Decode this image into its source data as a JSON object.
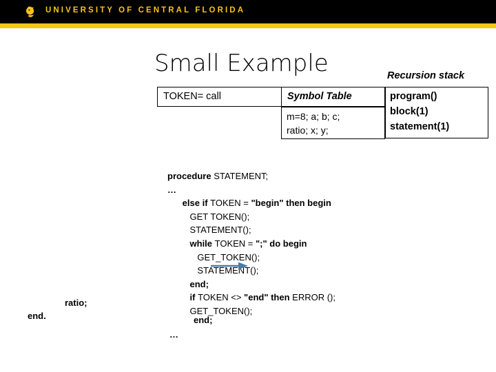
{
  "header": {
    "wordmark": "UNIVERSITY OF CENTRAL FLORIDA",
    "logo_icon": "ucf-pegasus-logo-icon",
    "bar_color": "#000000",
    "stripe_color": "#f5c518",
    "text_color": "#f5c518"
  },
  "slide": {
    "title": "Small Example"
  },
  "token_box": {
    "text": "TOKEN= call"
  },
  "symbol_table": {
    "header": "Symbol Table",
    "entries_line1": "m=8; a; b; c;",
    "entries_line2": "ratio; x; y;"
  },
  "recursion_stack": {
    "label": "Recursion stack",
    "frames": [
      "program()",
      "block(1)",
      "statement(1)"
    ]
  },
  "code": {
    "lines": [
      {
        "indent": 0,
        "segments": [
          {
            "text": "procedure ",
            "bold": true
          },
          {
            "text": "STATEMENT;",
            "bold": false
          }
        ]
      },
      {
        "indent": 0,
        "segments": [
          {
            "text": "…",
            "bold": true
          }
        ]
      },
      {
        "indent": 6,
        "segments": [
          {
            "text": "else if ",
            "bold": true
          },
          {
            "text": "TOKEN = ",
            "bold": false
          },
          {
            "text": "\"begin\" then begin",
            "bold": true
          }
        ]
      },
      {
        "indent": 9,
        "segments": [
          {
            "text": "GET TOKEN();",
            "bold": false
          }
        ]
      },
      {
        "indent": 9,
        "segments": [
          {
            "text": "STATEMENT();",
            "bold": false
          }
        ]
      },
      {
        "indent": 9,
        "segments": [
          {
            "text": "while ",
            "bold": true
          },
          {
            "text": "TOKEN = ",
            "bold": false
          },
          {
            "text": "\";\" do begin",
            "bold": true
          }
        ]
      },
      {
        "indent": 12,
        "segments": [
          {
            "text": "GET_TOKEN();",
            "bold": false
          }
        ]
      },
      {
        "indent": 12,
        "segments": [
          {
            "text": "STATEMENT();",
            "bold": false
          }
        ]
      },
      {
        "indent": 9,
        "segments": [
          {
            "text": "end;",
            "bold": true
          }
        ]
      },
      {
        "indent": 9,
        "segments": [
          {
            "text": "if ",
            "bold": true
          },
          {
            "text": "TOKEN <> ",
            "bold": false
          },
          {
            "text": "\"end\" then ",
            "bold": true
          },
          {
            "text": "ERROR ();",
            "bold": false
          }
        ]
      },
      {
        "indent": 9,
        "segments": [
          {
            "text": "GET_TOKEN();",
            "bold": false
          }
        ]
      }
    ]
  },
  "annotations": {
    "arrow_color": "#4a7ba7",
    "arrow_icon": "right-arrow-icon",
    "arrow_points_to": "STATEMENT();"
  },
  "fragments": {
    "ratio": "ratio;",
    "end_dot": "end.",
    "end_semi": "end;",
    "ellipsis": "…"
  }
}
